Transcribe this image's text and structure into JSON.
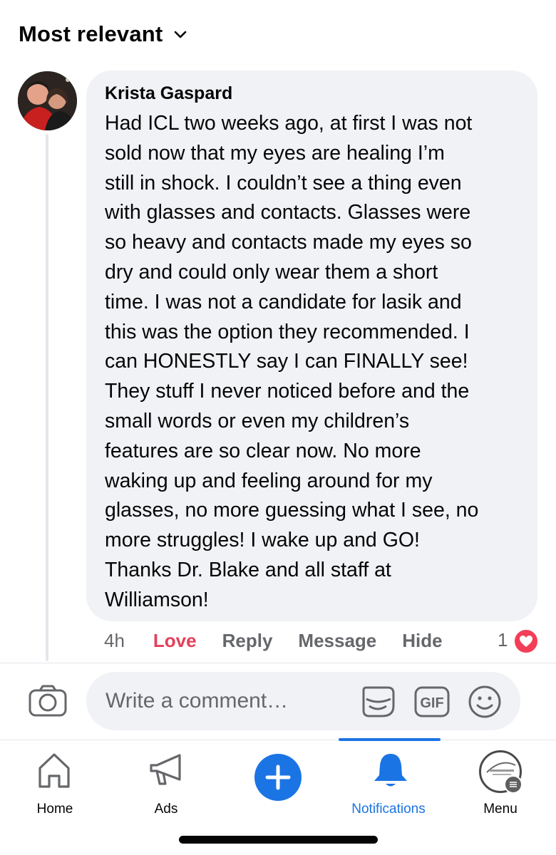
{
  "sort": {
    "label": "Most relevant",
    "icon": "chevron-down-icon"
  },
  "comment": {
    "author": "Krista Gaspard",
    "text": "Had ICL two weeks ago, at first I was not\nsold now that my eyes are healing I’m\nstill in shock. I couldn’t see a thing even\nwith glasses and contacts. Glasses were\nso heavy and contacts made my eyes so\ndry and could only wear them a short\ntime. I was not a candidate for lasik and\nthis was the option they recommended. I\ncan HONESTLY say I can FINALLY see!\nThey stuff I never noticed before and the\nsmall words or even my children’s\nfeatures are so clear now. No more\nwaking up and feeling around for my\nglasses, no more guessing what I see, no\nmore struggles! I wake up and GO!\nThanks Dr. Blake and all staff at\nWilliamson!",
    "time": "4h",
    "actions": {
      "love": "Love",
      "reply": "Reply",
      "message": "Message",
      "hide": "Hide"
    },
    "reaction_count": "1",
    "reaction_icon": "heart-icon"
  },
  "composer": {
    "placeholder": "Write a comment…",
    "icons": [
      "camera-icon",
      "sticker-icon",
      "gif-icon",
      "emoji-icon"
    ],
    "gif_label": "GIF"
  },
  "tabbar": {
    "active": "Notifications",
    "tabs": [
      {
        "label": "Home",
        "icon": "home-icon"
      },
      {
        "label": "Ads",
        "icon": "megaphone-icon"
      },
      {
        "label": "",
        "icon": "plus-icon"
      },
      {
        "label": "Notifications",
        "icon": "bell-icon"
      },
      {
        "label": "Menu",
        "icon": "menu-avatar-icon"
      }
    ]
  },
  "colors": {
    "accent": "#1b74e4",
    "love": "#e4405a",
    "heart_badge": "#f33e58",
    "bubble": "#f0f2f5",
    "secondary_text": "#65676b"
  }
}
